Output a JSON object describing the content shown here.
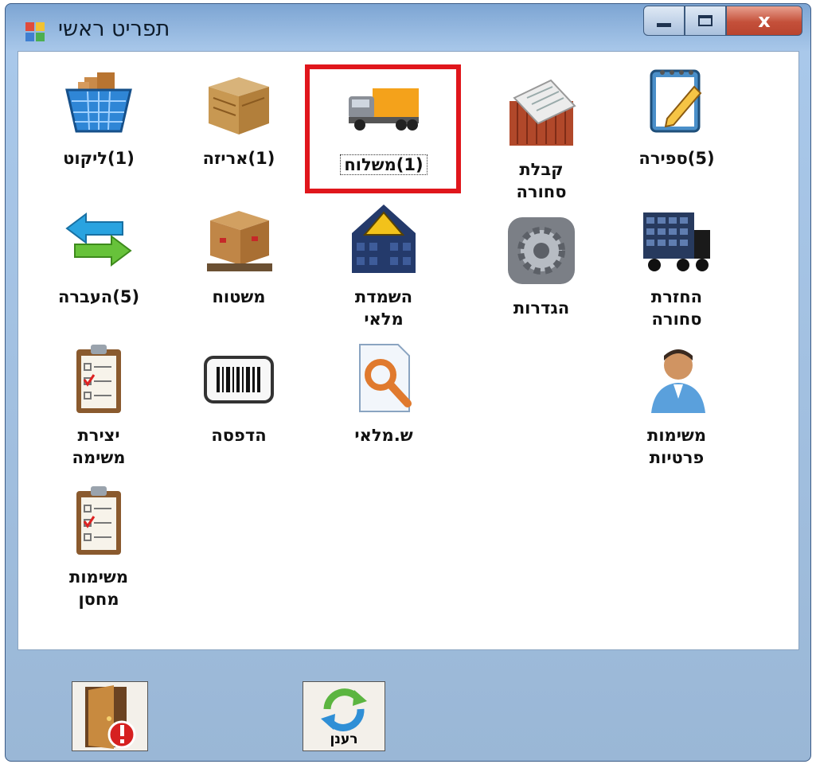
{
  "window": {
    "title": "תפריט ראשי",
    "close_label": "x"
  },
  "tiles": {
    "spira": "(5)ספירה",
    "kabala": "קבלת\nסחורה",
    "mishloah": "(1)משלוח",
    "ariza": "(1)אריזה",
    "likut": "(1)ליקוט",
    "hazara": "החזרת\nסחורה",
    "hagdarot": "הגדרות",
    "hashmada": "השמדת\nמלאי",
    "mishtah": "משטוח",
    "haavara": "(5)העברה",
    "personal_lists": "משימות\nפרטיות",
    "stock_query": "ש.מלאי",
    "print": "הדפסה",
    "create_list": "יצירת\nמשימה",
    "warehouse_lists": "משימות\nמחסן"
  },
  "buttons": {
    "refresh_label": "רענן"
  },
  "colors": {
    "selection_frame": "#e0161c",
    "window_border": "#3b5b86"
  }
}
